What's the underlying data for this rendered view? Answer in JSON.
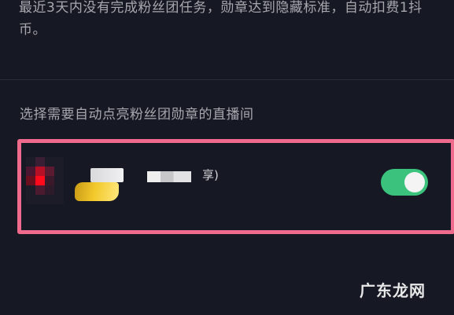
{
  "description": "最近3天内没有完成粉丝团任务，勋章达到隐藏标准，自动扣费1抖币。",
  "section_title": "选择需要自动点亮粉丝团勋章的直播间",
  "room": {
    "name_suffix": "享)",
    "toggle_on": true,
    "toggle_color": "#3bc27c",
    "highlight_color": "#ef6a8c"
  },
  "watermark": "广东龙网"
}
